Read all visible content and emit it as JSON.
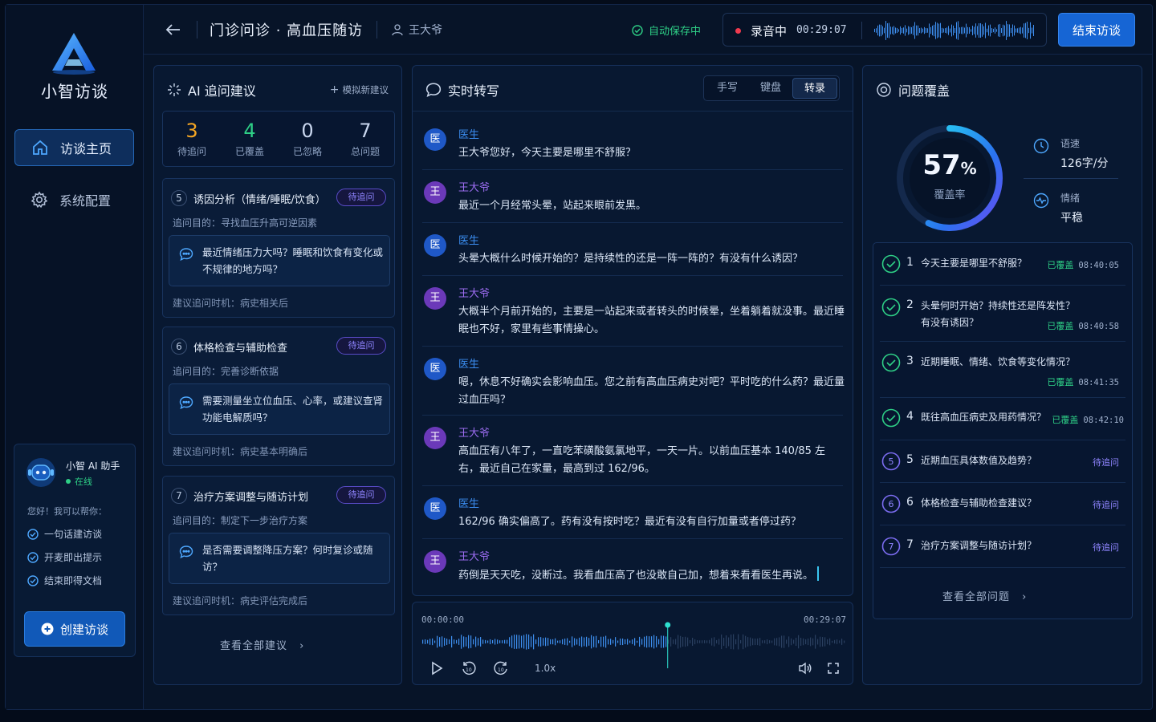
{
  "app": {
    "brand": "小智访谈"
  },
  "nav": [
    {
      "label": "访谈主页",
      "icon": "home-icon",
      "active": true
    },
    {
      "label": "系统配置",
      "icon": "gear-icon",
      "active": false
    }
  ],
  "assistant": {
    "name": "小智 AI 助手",
    "status": "在线",
    "greeting": "您好！我可以帮你：",
    "features": [
      "一句话建访谈",
      "开麦即出提示",
      "结束即得文档"
    ],
    "create_label": "创建访谈"
  },
  "header": {
    "title": "门诊问诊 · 高血压随访",
    "patient": "王大爷",
    "autosave": "自动保存中",
    "rec_label": "录音中",
    "rec_time": "00:29:07",
    "end_label": "结束访谈"
  },
  "ai_panel": {
    "title": "AI 追问建议",
    "simulate": "模拟新建议",
    "stats": [
      {
        "value": "3",
        "label": "待追问",
        "color": "#f5a623"
      },
      {
        "value": "4",
        "label": "已覆盖",
        "color": "#2ecf86"
      },
      {
        "value": "0",
        "label": "已忽略",
        "color": "#e6eefa"
      },
      {
        "value": "7",
        "label": "总问题",
        "color": "#e6eefa"
      }
    ],
    "cards": [
      {
        "num": "5",
        "title": "诱因分析（情绪/睡眠/饮食）",
        "tag": "待追问",
        "purpose": "追问目的：寻找血压升高可逆因素",
        "question": "最近情绪压力大吗？睡眠和饮食有变化或不规律的地方吗？",
        "timing": "建议追问时机：病史相关后"
      },
      {
        "num": "6",
        "title": "体格检查与辅助检查",
        "tag": "待追问",
        "purpose": "追问目的：完善诊断依据",
        "question": "需要测量坐立位血压、心率，或建议查肾功能电解质吗？",
        "timing": "建议追问时机：病史基本明确后"
      },
      {
        "num": "7",
        "title": "治疗方案调整与随访计划",
        "tag": "待追问",
        "purpose": "追问目的：制定下一步治疗方案",
        "question": "是否需要调整降压方案？何时复诊或随访？",
        "timing": "建议追问时机：病史评估完成后"
      }
    ],
    "more": "查看全部建议"
  },
  "transcript": {
    "title": "实时转写",
    "tabs": [
      "手写",
      "键盘",
      "转录"
    ],
    "active_tab": "转录",
    "messages": [
      {
        "role": "doc",
        "avatar": "医",
        "speaker": "医生",
        "text": "王大爷您好，今天主要是哪里不舒服？"
      },
      {
        "role": "pat",
        "avatar": "王",
        "speaker": "王大爷",
        "text": "最近一个月经常头晕，站起来眼前发黑。"
      },
      {
        "role": "doc",
        "avatar": "医",
        "speaker": "医生",
        "text": "头晕大概什么时候开始的？是持续性的还是一阵一阵的？有没有什么诱因？"
      },
      {
        "role": "pat",
        "avatar": "王",
        "speaker": "王大爷",
        "text": "大概半个月前开始的，主要是一站起来或者转头的时候晕，坐着躺着就没事。最近睡眠也不好，家里有些事情操心。"
      },
      {
        "role": "doc",
        "avatar": "医",
        "speaker": "医生",
        "text": "嗯，休息不好确实会影响血压。您之前有高血压病史对吧？平时吃的什么药？最近量过血压吗？"
      },
      {
        "role": "pat",
        "avatar": "王",
        "speaker": "王大爷",
        "text": "高血压有八年了，一直吃苯磺酸氨氯地平，一天一片。以前血压基本 140/85 左右，最近自己在家量，最高到过 162/96。"
      },
      {
        "role": "doc",
        "avatar": "医",
        "speaker": "医生",
        "text": "162/96 确实偏高了。药有没有按时吃？最近有没有自行加量或者停过药？"
      },
      {
        "role": "pat",
        "avatar": "王",
        "speaker": "王大爷",
        "text": "药倒是天天吃，没断过。我看血压高了也没敢自己加，想着来看看医生再说。"
      }
    ]
  },
  "player": {
    "start": "00:00:00",
    "end": "00:29:07",
    "speed": "1.0x",
    "progress": 0.58
  },
  "coverage": {
    "title": "问题覆盖",
    "percent": "57",
    "percent_unit": "%",
    "percent_value": 0.57,
    "percent_label": "覆盖率",
    "speed_label": "语速",
    "speed_value": "126字/分",
    "emotion_label": "情绪",
    "emotion_value": "平稳",
    "questions": [
      {
        "num": "1",
        "text": "今天主要是哪里不舒服？",
        "status": "已覆盖",
        "time": "08:40:05",
        "done": true
      },
      {
        "num": "2",
        "text": "头晕何时开始？持续性还是阵发性？有没有诱因？",
        "status": "已覆盖",
        "time": "08:40:58",
        "done": true
      },
      {
        "num": "3",
        "text": "近期睡眠、情绪、饮食等变化情况？",
        "status": "已覆盖",
        "time": "08:41:35",
        "done": true
      },
      {
        "num": "4",
        "text": "既往高血压病史及用药情况？",
        "status": "已覆盖",
        "time": "08:42:10",
        "done": true
      },
      {
        "num": "5",
        "text": "近期血压具体数值及趋势？",
        "status": "待追问",
        "time": "",
        "done": false
      },
      {
        "num": "6",
        "text": "体格检查与辅助检查建议？",
        "status": "待追问",
        "time": "",
        "done": false
      },
      {
        "num": "7",
        "text": "治疗方案调整与随访计划？",
        "status": "待追问",
        "time": "",
        "done": false
      }
    ],
    "more": "查看全部问题"
  }
}
